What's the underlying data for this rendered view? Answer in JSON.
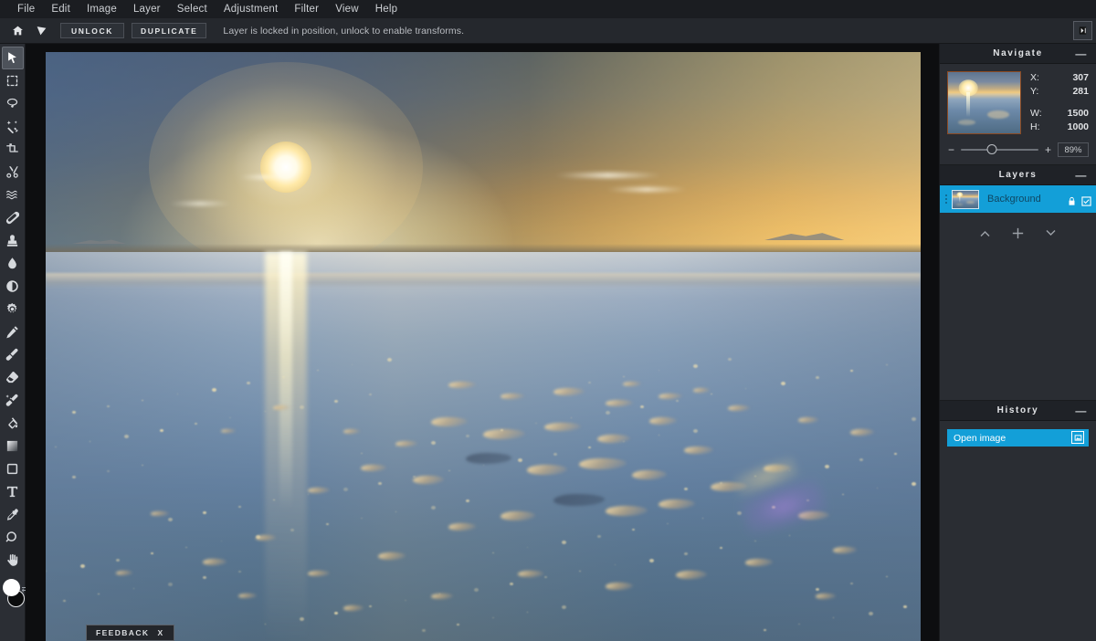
{
  "menubar": {
    "items": [
      {
        "label": "File"
      },
      {
        "label": "Edit"
      },
      {
        "label": "Image"
      },
      {
        "label": "Layer"
      },
      {
        "label": "Select"
      },
      {
        "label": "Adjustment"
      },
      {
        "label": "Filter"
      },
      {
        "label": "View"
      },
      {
        "label": "Help"
      }
    ]
  },
  "options_bar": {
    "home_icon": "home-icon",
    "tool_icon": "move-tool-icon",
    "unlock_label": "UNLOCK",
    "duplicate_label": "DUPLICATE",
    "hint": "Layer is locked in position, unlock to enable transforms.",
    "expand_icon": "panel-expand-icon"
  },
  "toolbar": {
    "tools": [
      {
        "name": "move-tool",
        "icon": "cursor-arrow-icon",
        "active": true
      },
      {
        "name": "marquee-select-tool",
        "icon": "dashed-rectangle-icon",
        "active": false
      },
      {
        "name": "lasso-tool",
        "icon": "lasso-icon",
        "active": false
      },
      {
        "name": "magic-wand-tool",
        "icon": "magic-wand-icon",
        "active": false
      },
      {
        "name": "crop-tool",
        "icon": "crop-icon",
        "active": false
      },
      {
        "name": "cut-tool",
        "icon": "scissors-icon",
        "active": false
      },
      {
        "name": "liquify-tool",
        "icon": "waves-icon",
        "active": false
      },
      {
        "name": "heal-tool",
        "icon": "bandage-icon",
        "active": false
      },
      {
        "name": "clone-stamp-tool",
        "icon": "stamp-icon",
        "active": false
      },
      {
        "name": "blur-tool",
        "icon": "water-drop-icon",
        "active": false
      },
      {
        "name": "dodge-burn-tool",
        "icon": "half-circle-icon",
        "active": false
      },
      {
        "name": "sharpen-tool",
        "icon": "gear-circle-icon",
        "active": false
      },
      {
        "name": "pencil-tool",
        "icon": "pencil-icon",
        "active": false
      },
      {
        "name": "paintbrush-tool",
        "icon": "paintbrush-icon",
        "active": false
      },
      {
        "name": "eraser-tool",
        "icon": "eraser-icon",
        "active": false
      },
      {
        "name": "effect-brush-tool",
        "icon": "sparkle-brush-icon",
        "active": false
      },
      {
        "name": "paint-bucket-tool",
        "icon": "paint-bucket-icon",
        "active": false
      },
      {
        "name": "gradient-tool",
        "icon": "gradient-square-icon",
        "active": false
      },
      {
        "name": "shape-tool",
        "icon": "rounded-shape-icon",
        "active": false
      },
      {
        "name": "text-tool",
        "icon": "text-t-icon",
        "active": false
      },
      {
        "name": "eyedropper-tool",
        "icon": "eyedropper-icon",
        "active": false
      },
      {
        "name": "zoom-tool",
        "icon": "magnifier-icon",
        "active": false
      },
      {
        "name": "hand-tool",
        "icon": "hand-icon",
        "active": false
      }
    ],
    "foreground_color": "#ffffff",
    "background_color": "#0b0c0d",
    "swap_icon": "swap-colors-icon"
  },
  "canvas": {
    "feedback_label": "FEEDBACK",
    "feedback_close": "X"
  },
  "panels": {
    "navigate": {
      "title": "Navigate",
      "minimize": "—",
      "thumbnail_name": "navigator-thumbnail",
      "stats": [
        {
          "key": "X:",
          "value": "307"
        },
        {
          "key": "Y:",
          "value": "281"
        },
        {
          "key": "W:",
          "value": "1500"
        },
        {
          "key": "H:",
          "value": "1000"
        }
      ],
      "zoom_out": "−",
      "zoom_in": "+",
      "zoom_value": "89%"
    },
    "layers": {
      "title": "Layers",
      "minimize": "—",
      "rows": [
        {
          "name": "Background",
          "locked": true,
          "visible": true,
          "selected": true
        }
      ],
      "actions": [
        {
          "name": "move-layer-up-button",
          "icon": "chevron-up-icon"
        },
        {
          "name": "add-layer-button",
          "icon": "plus-icon"
        },
        {
          "name": "move-layer-down-button",
          "icon": "chevron-down-icon"
        }
      ]
    },
    "history": {
      "title": "History",
      "minimize": "—",
      "items": [
        {
          "label": "Open image",
          "icon": "image-icon"
        }
      ]
    }
  },
  "colors": {
    "menubar_bg": "#1b1d21",
    "options_bg": "#25282d",
    "panel_bg": "#2a2d33",
    "panel_header_bg": "#1f2227",
    "accent": "#139fd8",
    "toolbar_bg": "#2b2e34",
    "canvas_bg": "#0d0e10"
  }
}
